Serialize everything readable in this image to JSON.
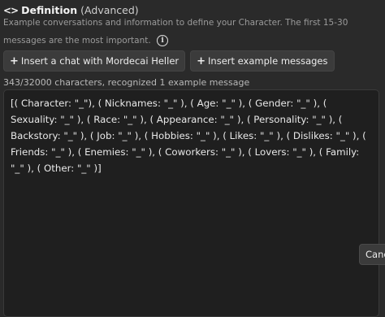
{
  "definition": {
    "title": "Definition",
    "subtitle": "(Advanced)",
    "description": "Example conversations and information to define your Character. The first 15-30 messages are the most important.",
    "code_icon": "code-icon",
    "info_icon": "info-icon"
  },
  "buttons": {
    "insert_chat": "Insert a chat with Mordecai Heller",
    "insert_examples": "Insert example messages",
    "plus_icon": "+"
  },
  "status": {
    "char_count": "343/32000 characters, recognized 1 example message"
  },
  "editor": {
    "value": "[( Character: \"_\"), ( Nicknames: \"_\" ), ( Age: \"_\" ), ( Gender: \"_\" ), ( Sexuality: \"_\" ), ( Race: \"_\" ), ( Appearance: \"_\" ), ( Personality: \"_\" ), ( Backstory: \"_\" ), ( Job: \"_\" ), ( Hobbies: \"_\" ), ( Likes: \"_\" ), ( Dislikes: \"_\" ), ( Friends: \"_\" ), ( Enemies: \"_\" ), ( Coworkers: \"_\" ), ( Lovers: \"_\" ), ( Family: \"_\" ), ( Other: \"_\" )]"
  },
  "actions": {
    "cancel_label": "Cancel"
  }
}
